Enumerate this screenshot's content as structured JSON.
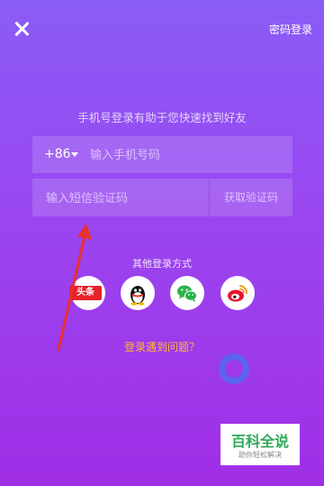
{
  "header": {
    "password_login": "密码登录"
  },
  "subtitle": "手机号登录有助于您快速找到好友",
  "phone": {
    "country_code": "+86",
    "placeholder": "输入手机号码"
  },
  "sms": {
    "placeholder": "输入短信验证码",
    "get_code": "获取验证码"
  },
  "other_login": {
    "label": "其他登录方式",
    "toutiao_text": "头条",
    "providers": [
      "toutiao-icon",
      "qq-icon",
      "wechat-icon",
      "weibo-icon"
    ]
  },
  "problem_link": "登录遇到问题？",
  "watermark": {
    "title": "百科全说",
    "subtitle": "助你轻松解决"
  },
  "colors": {
    "background_top": "#8a5cf6",
    "background_bottom": "#a02ee6",
    "problem_link": "#ffb340",
    "annotation_arrow": "#e8302e",
    "watermark_green": "#2ea85a"
  }
}
